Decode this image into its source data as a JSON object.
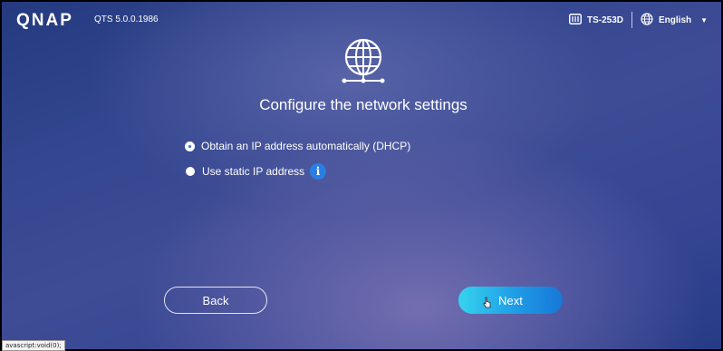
{
  "header": {
    "logo": "QNAP",
    "version": "QTS 5.0.0.1986",
    "device_name": "TS-253D",
    "language": "English",
    "icons": [
      "nas-device-icon",
      "globe-icon",
      "caret-down-icon"
    ]
  },
  "main": {
    "title": "Configure the network settings",
    "header_icon": "globe-network-icon",
    "options": [
      {
        "label": "Obtain an IP address automatically (DHCP)",
        "selected": true
      },
      {
        "label": "Use static IP address",
        "selected": false
      }
    ],
    "info_icon_glyph": "i"
  },
  "footer": {
    "back_label": "Back",
    "next_label": "Next"
  },
  "status_bar": {
    "text": "avascript:void(0);"
  },
  "colors": {
    "background": "#3a4a93",
    "next_button": "#1f9ce6",
    "info_icon": "#2a7ee3"
  }
}
